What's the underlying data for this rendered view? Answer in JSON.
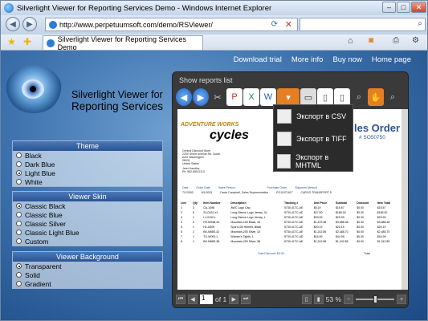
{
  "window": {
    "title": "Silverlight Viewer for Reporting Services Demo - Windows Internet Explorer"
  },
  "address": {
    "url": "http://www.perpetuumsoft.com/demo/RSViewer/"
  },
  "tab": {
    "label": "Silverlight Viewer for Reporting Services Demo"
  },
  "topnav": [
    "Download trial",
    "More info",
    "Buy now",
    "Home page"
  ],
  "brand": {
    "line1": "Silverlight Viewer for",
    "line2": "Reporting Services"
  },
  "panels": {
    "theme": {
      "title": "Theme",
      "options": [
        "Black",
        "Dark Blue",
        "Light Blue",
        "White"
      ],
      "selected": 2
    },
    "skin": {
      "title": "Viewer Skin",
      "options": [
        "Classic Black",
        "Classic Blue",
        "Classic Silver",
        "Classic Light Blue",
        "Custom"
      ],
      "selected": 0
    },
    "background": {
      "title": "Viewer Background",
      "options": [
        "Transparent",
        "Solid",
        "Gradient"
      ],
      "selected": 0
    }
  },
  "viewer": {
    "show_reports": "Show reports list",
    "export_menu": [
      "Экспорт в CSV",
      "Экспорт в TIFF",
      "Экспорт в MHTML"
    ],
    "page_of": "of 1",
    "page": "1",
    "zoom": "53 %"
  },
  "report": {
    "brand_left": "ADVENTURE WORKS",
    "brand_right": "cycles",
    "title": "les Order",
    "order_no": "# SO50750",
    "bill_to": [
      "Central Discount Store",
      "2250 Shore Avenue Rd. South",
      "Kent",
      "Washington",
      "98031",
      "United States"
    ],
    "contact": "Jean Handley",
    "phone": "Ph: 582-555-0113",
    "meta_labels": [
      "Date",
      "Order Date",
      "Sales Person",
      "Purchase Order",
      "Shipment Method"
    ],
    "meta_values": [
      "7/1/2003",
      "6/1/2003",
      "David Campbell, Sales Representative",
      "PO11971617",
      "CARGO TRANSPORT 5"
    ],
    "columns": [
      "Line",
      "Qty",
      "Item Number",
      "Description",
      "Tracking #",
      "Unit Price",
      "Subtotal",
      "Discount",
      "Item Total"
    ],
    "rows": [
      [
        "1",
        "3",
        "CA-1098",
        "AWC Logo Cap",
        "5730-41TC-AE",
        "$5.19",
        "$15.57",
        "$0.00",
        "$15.57"
      ],
      [
        "2",
        "6",
        "SJ-0192-XL",
        "Long-Sleeve Logo Jersey, XL",
        "5730-41TC-AE",
        "$27.50",
        "$165.00",
        "$0.00",
        "$165.00"
      ],
      [
        "3",
        "1",
        "LJ-0192-L",
        "Long-Sleeve Logo Jersey, L",
        "5730-41TC-AE",
        "$29.99",
        "$29.99",
        "$0.00",
        "$29.99"
      ],
      [
        "4",
        "3",
        "FR-M94B-44",
        "Mountain-100 Black, 44",
        "5730-41TC-AE",
        "$1,229.46",
        "$3,688.38",
        "$0.00",
        "$3,688.38"
      ],
      [
        "5",
        "1",
        "HL-U509",
        "Sport-100 Helmet, Black",
        "5730-41TC-AE",
        "$20.19",
        "$20.19",
        "$0.00",
        "$20.19"
      ],
      [
        "6",
        "2",
        "BK-M68S-42",
        "Mountain-200 Silver, 42",
        "5730-41TC-AE",
        "$1,242.85",
        "$2,485.70",
        "$0.00",
        "$2,485.70"
      ],
      [
        "7",
        "1",
        "TG-W091-L",
        "Women's Tights, L",
        "5730-41TC-AE",
        "$44.99",
        "$44.99",
        "$0.00",
        "$44.99"
      ],
      [
        "8",
        "1",
        "BK-M68S-38",
        "Mountain-200 Silver, 38",
        "5730-41TC-AE",
        "$1,242.85",
        "$1,242.85",
        "$0.00",
        "$1,242.85"
      ]
    ],
    "total_label": "Total Discount: $0.00",
    "total_right": "Total:"
  }
}
